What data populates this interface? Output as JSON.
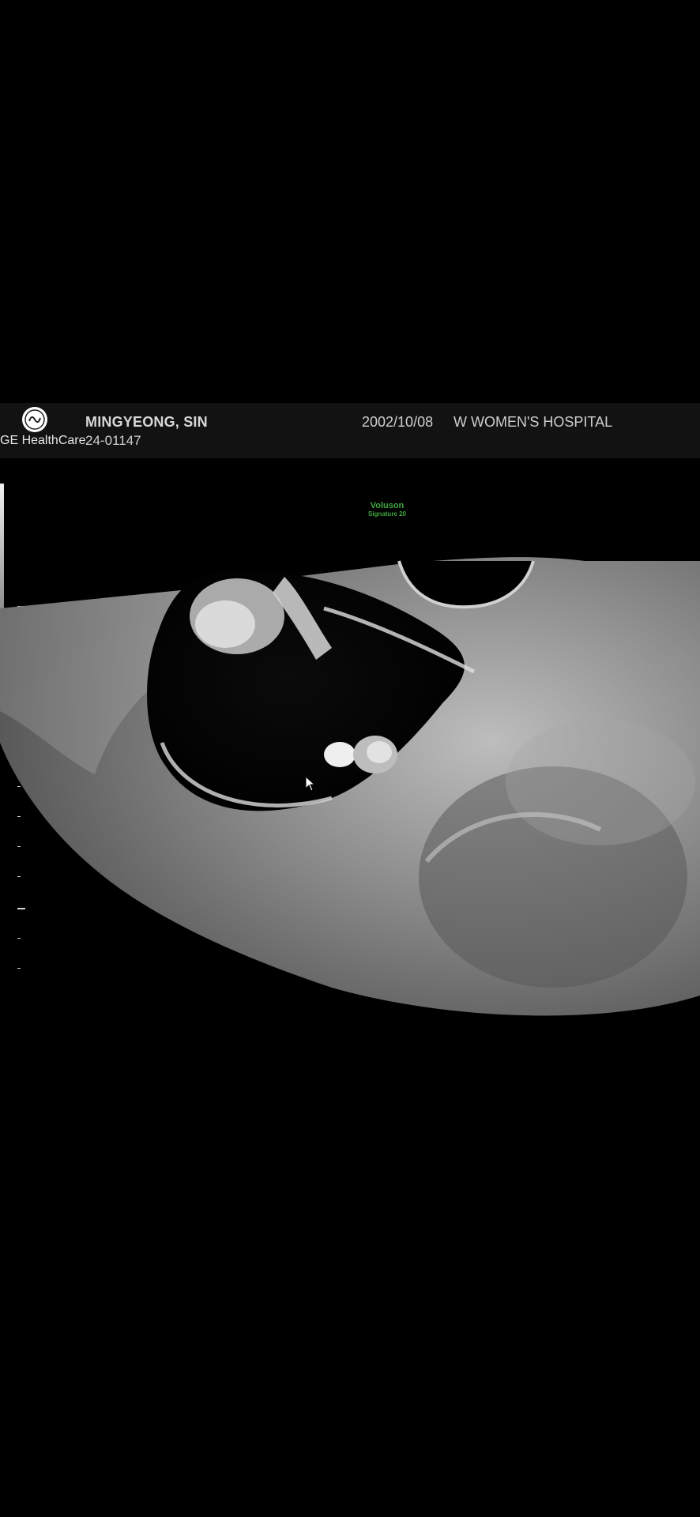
{
  "header": {
    "logo_text": "GE HealthCare",
    "patient_name": "MINGYEONG, SIN",
    "patient_id": "24-01147",
    "exam_date": "2002/10/08",
    "hospital": "W WOMEN'S HOSPITAL"
  },
  "brand": {
    "line1": "Voluson",
    "line2": "Signature 20",
    "color": "#3fa63f"
  },
  "icons": {
    "logo": "ge-monogram-icon",
    "cursor": "mouse-pointer-icon",
    "focus": "focus-marker-icon"
  }
}
